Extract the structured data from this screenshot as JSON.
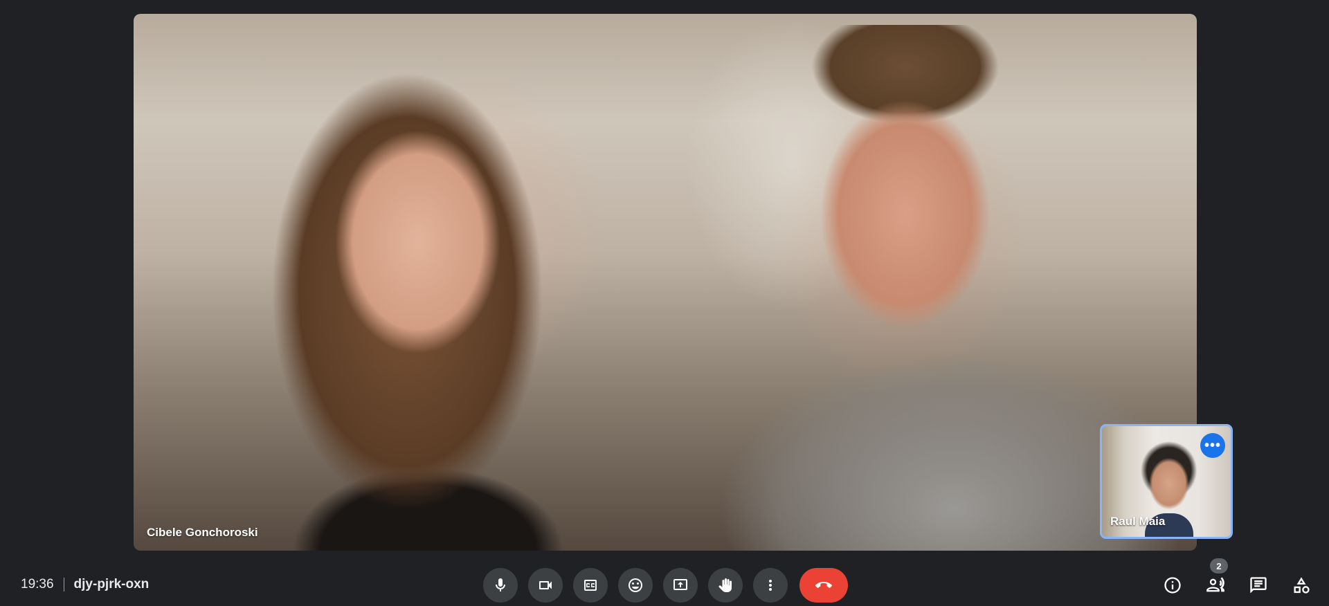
{
  "main_video": {
    "participant_name": "Cibele Gonchoroski"
  },
  "self_view": {
    "participant_name": "Raul Maia",
    "more_options_icon": "more-horiz-icon"
  },
  "meeting": {
    "time": "19:36",
    "code": "djy-pjrk-oxn"
  },
  "controls": [
    {
      "name": "microphone-button",
      "icon": "mic-icon"
    },
    {
      "name": "camera-button",
      "icon": "videocam-icon"
    },
    {
      "name": "captions-button",
      "icon": "closed-caption-icon"
    },
    {
      "name": "reactions-button",
      "icon": "emoji-icon"
    },
    {
      "name": "present-button",
      "icon": "present-screen-icon"
    },
    {
      "name": "raise-hand-button",
      "icon": "hand-icon"
    },
    {
      "name": "more-options-button",
      "icon": "more-vert-icon"
    },
    {
      "name": "leave-call-button",
      "icon": "call-end-icon",
      "color": "#ea4335"
    }
  ],
  "side_controls": {
    "info": {
      "icon": "info-icon"
    },
    "people": {
      "icon": "people-icon",
      "count": "2"
    },
    "chat": {
      "icon": "chat-icon"
    },
    "activities": {
      "icon": "activities-icon"
    }
  },
  "colors": {
    "background": "#202124",
    "button": "#3c4043",
    "accent": "#8ab4f8",
    "end_call": "#ea4335"
  }
}
